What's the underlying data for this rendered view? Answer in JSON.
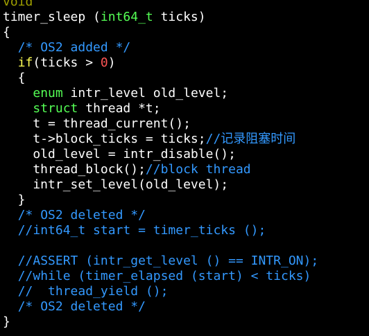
{
  "colors": {
    "background": "#000000",
    "default": "#ffffff",
    "keyword": "#ffff55",
    "type": "#55ff55",
    "comment": "#3399ff",
    "number": "#ff5555",
    "dim": "#a0a000"
  },
  "lines": [
    [
      {
        "t": "void",
        "c": "dim"
      }
    ],
    [
      {
        "t": "timer_sleep (",
        "c": "default"
      },
      {
        "t": "int64_t",
        "c": "type"
      },
      {
        "t": " ticks)",
        "c": "default"
      }
    ],
    [
      {
        "t": "{",
        "c": "default"
      }
    ],
    [
      {
        "t": "  ",
        "c": "default"
      },
      {
        "t": "/* OS2 added */",
        "c": "comment"
      }
    ],
    [
      {
        "t": "  ",
        "c": "default"
      },
      {
        "t": "if",
        "c": "keyword"
      },
      {
        "t": "(ticks > ",
        "c": "default"
      },
      {
        "t": "0",
        "c": "number"
      },
      {
        "t": ")",
        "c": "default"
      }
    ],
    [
      {
        "t": "  {",
        "c": "default"
      }
    ],
    [
      {
        "t": "    ",
        "c": "default"
      },
      {
        "t": "enum",
        "c": "type"
      },
      {
        "t": " intr_level old_level;",
        "c": "default"
      }
    ],
    [
      {
        "t": "    ",
        "c": "default"
      },
      {
        "t": "struct",
        "c": "type"
      },
      {
        "t": " thread *t;",
        "c": "default"
      }
    ],
    [
      {
        "t": "    t = thread_current();",
        "c": "default"
      }
    ],
    [
      {
        "t": "    t->block_ticks = ticks;",
        "c": "default"
      },
      {
        "t": "//记录阻塞时间",
        "c": "comment"
      }
    ],
    [
      {
        "t": "    old_level = intr_disable();",
        "c": "default"
      }
    ],
    [
      {
        "t": "    thread_block();",
        "c": "default"
      },
      {
        "t": "//block thread",
        "c": "comment"
      }
    ],
    [
      {
        "t": "    intr_set_level(old_level);",
        "c": "default"
      }
    ],
    [
      {
        "t": "  }",
        "c": "default"
      }
    ],
    [
      {
        "t": "  ",
        "c": "default"
      },
      {
        "t": "/* OS2 deleted */",
        "c": "comment"
      }
    ],
    [
      {
        "t": "  ",
        "c": "default"
      },
      {
        "t": "//int64_t start = timer_ticks ();",
        "c": "comment"
      }
    ],
    [
      {
        "t": "",
        "c": "default"
      }
    ],
    [
      {
        "t": "  ",
        "c": "default"
      },
      {
        "t": "//ASSERT (intr_get_level () == INTR_ON);",
        "c": "comment"
      }
    ],
    [
      {
        "t": "  ",
        "c": "default"
      },
      {
        "t": "//while (timer_elapsed (start) < ticks)",
        "c": "comment"
      }
    ],
    [
      {
        "t": "  ",
        "c": "default"
      },
      {
        "t": "//  thread_yield ();",
        "c": "comment"
      }
    ],
    [
      {
        "t": "  ",
        "c": "default"
      },
      {
        "t": "/* OS2 deleted */",
        "c": "comment"
      }
    ],
    [
      {
        "t": "}",
        "c": "default"
      }
    ]
  ]
}
